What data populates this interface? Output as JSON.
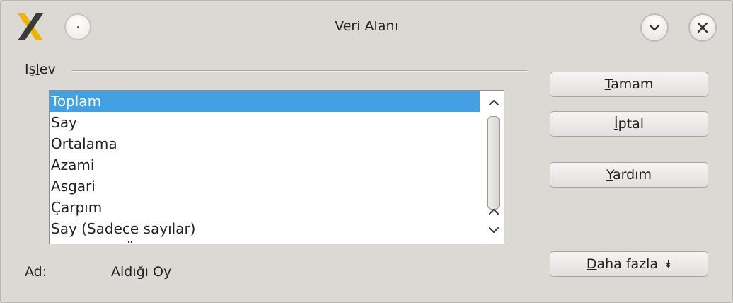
{
  "window": {
    "title": "Veri Alanı"
  },
  "function_group": {
    "label_accel": "Iş",
    "label_rest_underlined": "l",
    "label_rest": "ev"
  },
  "function_list": {
    "items": [
      {
        "label": "Toplam",
        "selected": true
      },
      {
        "label": "Say",
        "selected": false
      },
      {
        "label": "Ortalama",
        "selected": false
      },
      {
        "label": "Azami",
        "selected": false
      },
      {
        "label": "Asgari",
        "selected": false
      },
      {
        "label": "Çarpım",
        "selected": false
      },
      {
        "label": "Say (Sadece sayılar)",
        "selected": false
      },
      {
        "label": "StSapma (Örnek)",
        "selected": false
      }
    ],
    "selection_color": "#43a0e2"
  },
  "name_field": {
    "label": "Ad:",
    "value": "Aldığı Oy"
  },
  "buttons": {
    "ok": {
      "accel": "T",
      "rest": "amam"
    },
    "cancel": {
      "accel": "İ",
      "rest": "ptal"
    },
    "help": {
      "accel": "Y",
      "rest": "ardım"
    },
    "more": {
      "accel": "D",
      "rest": "aha fazla",
      "arrow": "⯯"
    }
  },
  "icons": {
    "app": "x-logo-icon",
    "pin": "pin-dot-icon",
    "minimize": "chevron-down-icon",
    "close": "close-icon",
    "scroll_up": "chevron-up-icon",
    "scroll_down": "chevron-down-icon"
  }
}
